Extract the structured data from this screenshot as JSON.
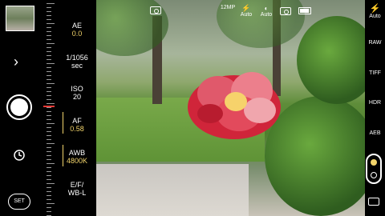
{
  "left": {
    "thumbnail_icon": "photo-thumbnail",
    "expand_icon": "chevron-right",
    "timer_icon": "self-timer",
    "set_label": "SET"
  },
  "settings": [
    {
      "label": "AE",
      "value": "0.0"
    },
    {
      "label": "1/1056",
      "value": "sec"
    },
    {
      "label": "ISO",
      "value": "20"
    },
    {
      "label": "AF",
      "value": "0.58"
    },
    {
      "label": "AWB",
      "value": "4800K"
    },
    {
      "label": "E/F/",
      "value": "WB-L"
    }
  ],
  "top": {
    "camera_icon": "camera-icon",
    "resolution": "12MP",
    "flash_label": "Auto",
    "hdr_label": "Auto",
    "photo_mode_icon": "camera-icon",
    "battery_icon": "battery-icon"
  },
  "right": {
    "flash_label": "Auto",
    "raw": "RAW",
    "tiff": "TIFF",
    "hdr": "HDR",
    "aeb": "AEB",
    "toggle_icon": "mode-toggle",
    "switch_icon": "switch-camera-icon"
  },
  "colors": {
    "accent": "#f2d46b",
    "marker": "#e53935"
  }
}
